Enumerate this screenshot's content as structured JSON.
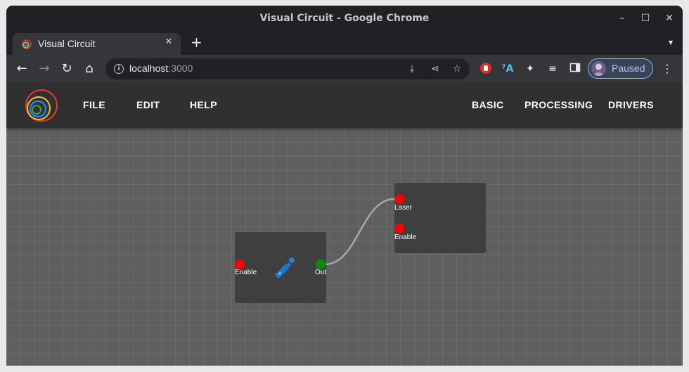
{
  "window": {
    "title": "Visual Circuit - Google Chrome"
  },
  "tab": {
    "title": "Visual Circuit"
  },
  "address": {
    "host": "localhost",
    "port": ":3000"
  },
  "profile": {
    "label": "Paused"
  },
  "app": {
    "left_menu": [
      "FILE",
      "EDIT",
      "HELP"
    ],
    "right_menu": [
      "BASIC",
      "PROCESSING",
      "DRIVERS"
    ]
  },
  "nodes": {
    "laser_block": {
      "input_label": "Enable",
      "output_label": "Out",
      "icon": "laser-pointer-icon"
    },
    "laser_driver": {
      "inputs": [
        "Laser",
        "Enable"
      ]
    }
  },
  "colors": {
    "input_port": "#ff0000",
    "output_port": "#0b8a0b",
    "node_bg": "#3f3f3f",
    "canvas_bg": "#5f5f5f",
    "appbar_bg": "#303030"
  }
}
